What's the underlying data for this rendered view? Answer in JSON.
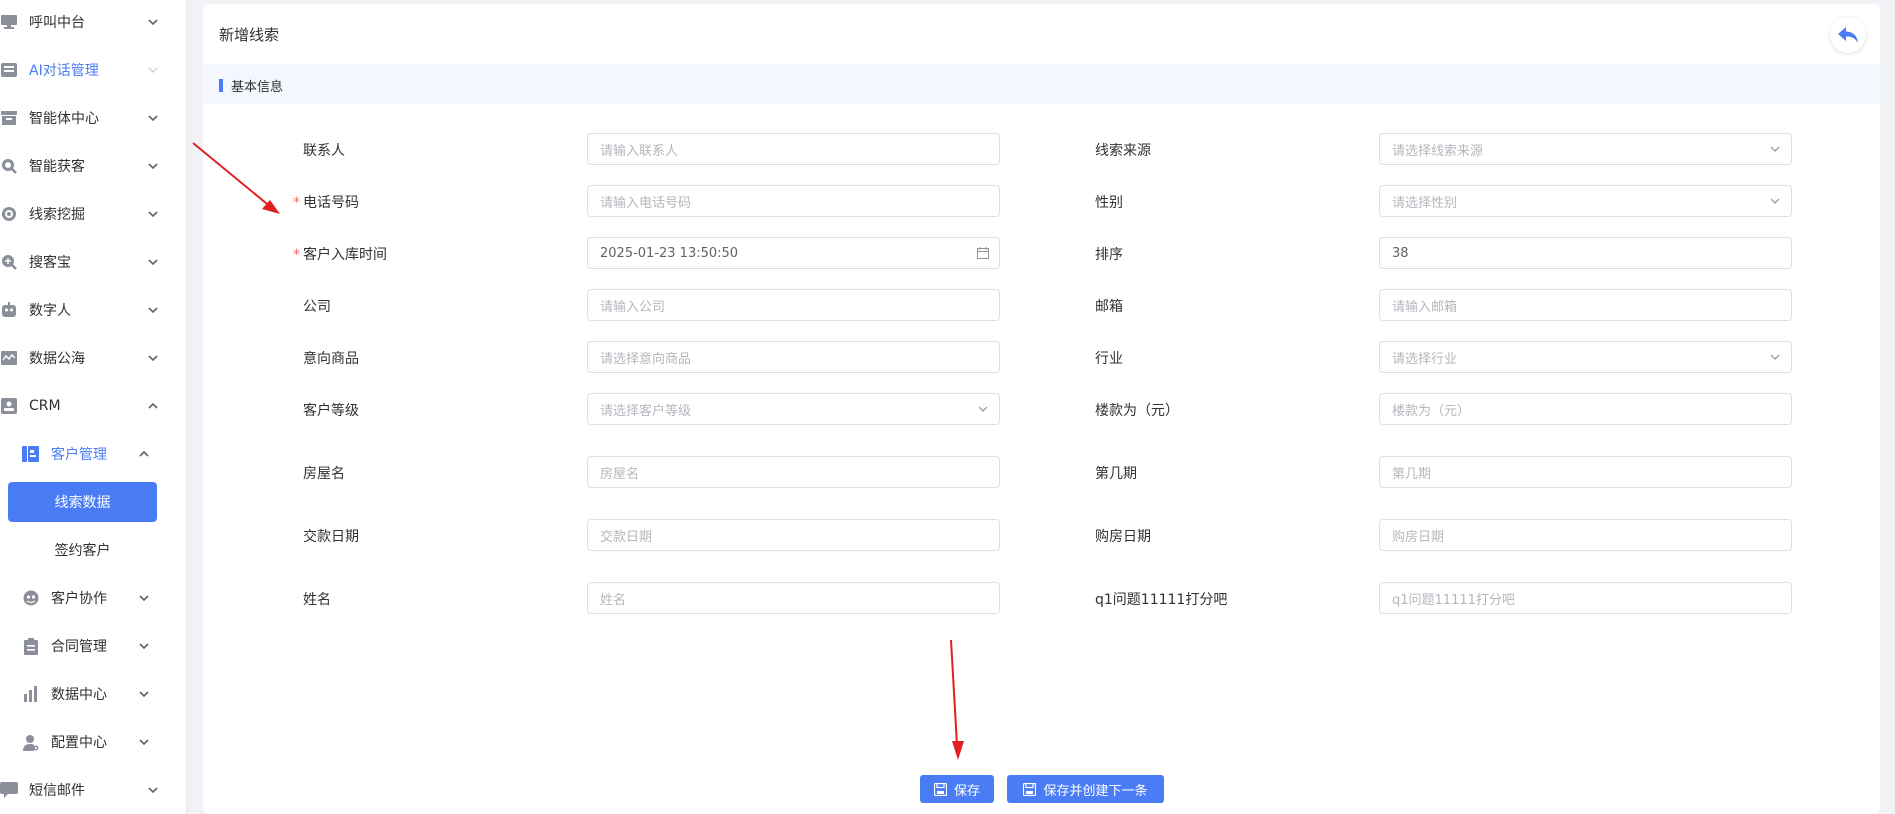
{
  "sidebar": {
    "items": [
      {
        "label": "呼叫中台",
        "icon": "monitor-icon"
      },
      {
        "label": "AI对话管理",
        "icon": "book-icon"
      },
      {
        "label": "智能体中心",
        "icon": "box-icon"
      },
      {
        "label": "智能获客",
        "icon": "search-circle-icon"
      },
      {
        "label": "线索挖掘",
        "icon": "target-icon"
      },
      {
        "label": "搜客宝",
        "icon": "search-plus-icon"
      },
      {
        "label": "数字人",
        "icon": "robot-icon"
      },
      {
        "label": "数据公海",
        "icon": "chart-wave-icon"
      },
      {
        "label": "CRM",
        "icon": "id-card-icon"
      },
      {
        "label": "短信邮件",
        "icon": "message-icon"
      }
    ],
    "sub": {
      "customer_mgmt": "客户管理",
      "leads_data": "线索数据",
      "signed_customers": "签约客户",
      "collab": "客户协作",
      "contract": "合同管理",
      "data_center": "数据中心",
      "config": "配置中心"
    }
  },
  "page": {
    "title": "新增线索",
    "section": "基本信息"
  },
  "form": {
    "left": [
      {
        "label": "联系人",
        "required": false,
        "value": "",
        "placeholder": "请输入联系人"
      },
      {
        "label": "电话号码",
        "required": true,
        "value": "",
        "placeholder": "请输入电话号码"
      },
      {
        "label": "客户入库时间",
        "required": true,
        "value": "2025-01-23 13:50:50",
        "placeholder": ""
      },
      {
        "label": "公司",
        "required": false,
        "value": "",
        "placeholder": "请输入公司"
      },
      {
        "label": "意向商品",
        "required": false,
        "value": "",
        "placeholder": "请选择意向商品"
      },
      {
        "label": "客户等级",
        "required": false,
        "value": "",
        "placeholder": "请选择客户等级"
      },
      {
        "label": "房屋名",
        "required": false,
        "value": "",
        "placeholder": "房屋名"
      },
      {
        "label": "交款日期",
        "required": false,
        "value": "",
        "placeholder": "交款日期"
      },
      {
        "label": "姓名",
        "required": false,
        "value": "",
        "placeholder": "姓名"
      }
    ],
    "right": [
      {
        "label": "线索来源",
        "value": "",
        "placeholder": "请选择线索来源"
      },
      {
        "label": "性别",
        "value": "",
        "placeholder": "请选择性别"
      },
      {
        "label": "排序",
        "value": "38",
        "placeholder": ""
      },
      {
        "label": "邮箱",
        "value": "",
        "placeholder": "请输入邮箱"
      },
      {
        "label": "行业",
        "value": "",
        "placeholder": "请选择行业"
      },
      {
        "label": "楼款为（元）",
        "value": "",
        "placeholder": "楼款为（元）"
      },
      {
        "label": "第几期",
        "value": "",
        "placeholder": "第几期"
      },
      {
        "label": "购房日期",
        "value": "",
        "placeholder": "购房日期"
      },
      {
        "label": "q1问题11111打分吧",
        "value": "",
        "placeholder": "q1问题11111打分吧"
      }
    ]
  },
  "actions": {
    "save": "保存",
    "save_next": "保存并创建下一条"
  },
  "colors": {
    "accent": "#4a7cf5",
    "required": "#f56c6c",
    "annotation_arrow": "#e02020"
  }
}
